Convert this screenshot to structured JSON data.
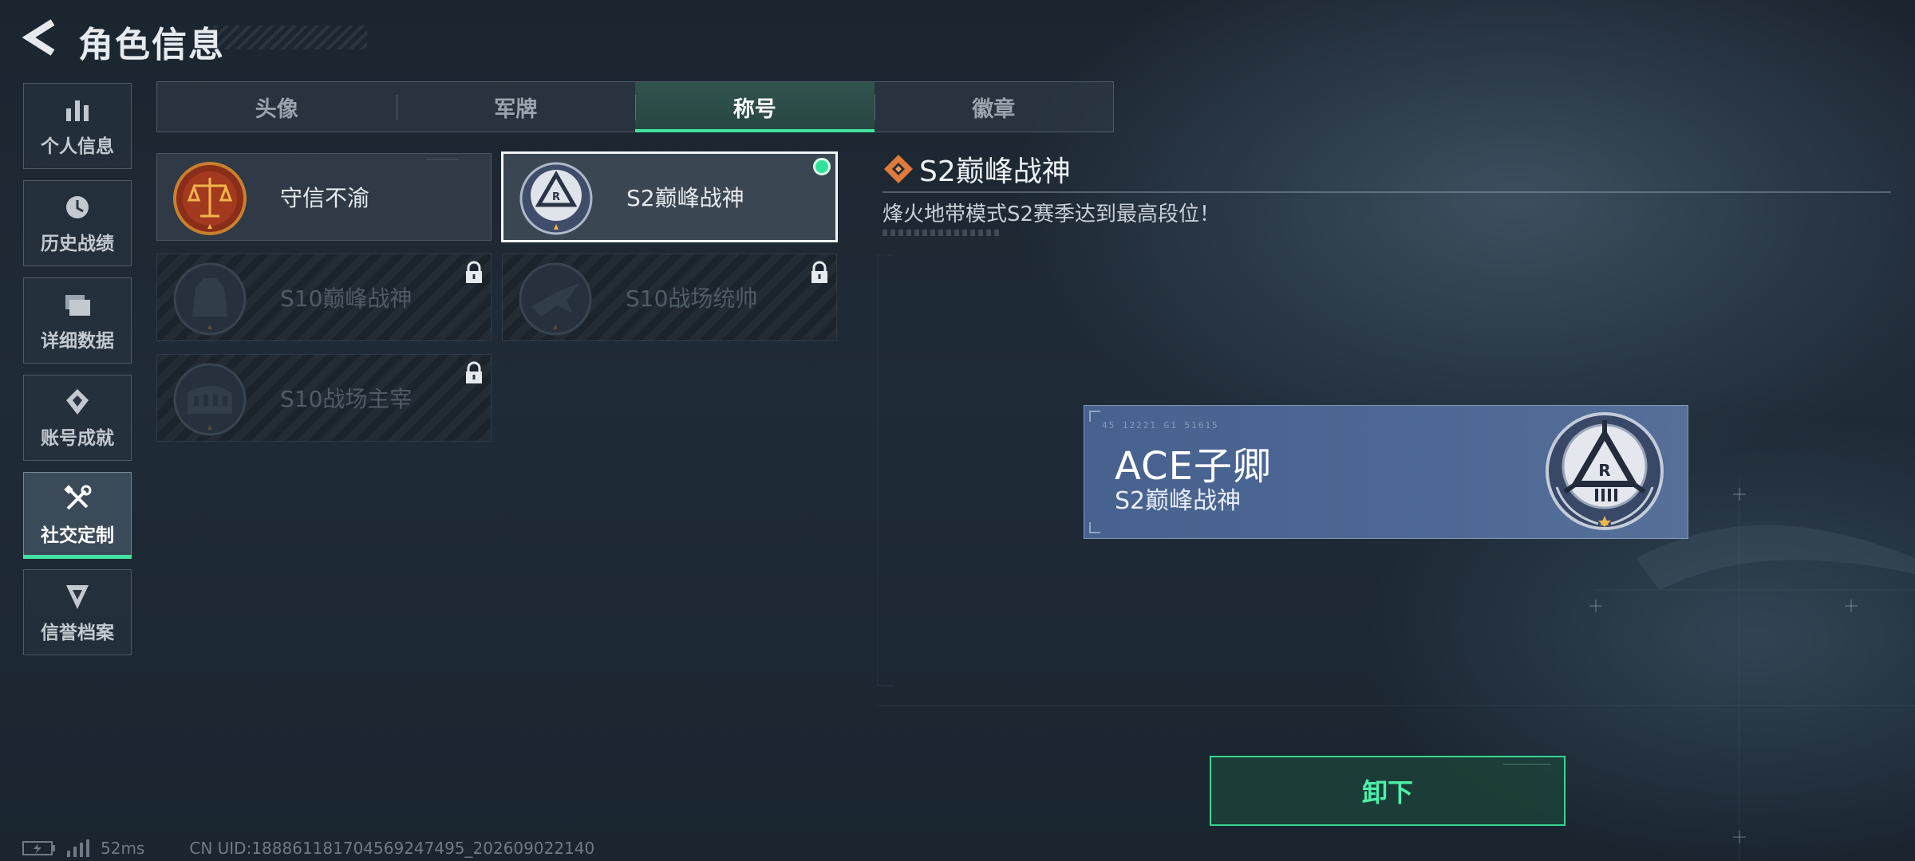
{
  "header": {
    "title": "角色信息"
  },
  "sidebar": {
    "items": [
      {
        "label": "个人信息",
        "icon": "bar-chart-icon",
        "active": false
      },
      {
        "label": "历史战绩",
        "icon": "clock-icon",
        "active": false
      },
      {
        "label": "详细数据",
        "icon": "folders-icon",
        "active": false
      },
      {
        "label": "账号成就",
        "icon": "achievement-icon",
        "active": false
      },
      {
        "label": "社交定制",
        "icon": "tools-icon",
        "active": true
      },
      {
        "label": "信誉档案",
        "icon": "shield-emblem-icon",
        "active": false
      }
    ]
  },
  "tabs": [
    {
      "label": "头像",
      "active": false
    },
    {
      "label": "军牌",
      "active": false
    },
    {
      "label": "称号",
      "active": true
    },
    {
      "label": "徽章",
      "active": false
    }
  ],
  "titles": [
    {
      "name": "守信不渝",
      "icon": "scales-badge-icon",
      "locked": false,
      "selected": false,
      "equipped": false
    },
    {
      "name": "S2巅峰战神",
      "icon": "rank-emblem-icon",
      "locked": false,
      "selected": true,
      "equipped": true
    },
    {
      "name": "S10巅峰战神",
      "icon": "building-badge-icon",
      "locked": true,
      "selected": false,
      "equipped": false
    },
    {
      "name": "S10战场统帅",
      "icon": "aircraft-badge-icon",
      "locked": true,
      "selected": false,
      "equipped": false
    },
    {
      "name": "S10战场主宰",
      "icon": "colosseum-badge-icon",
      "locked": true,
      "selected": false,
      "equipped": false
    }
  ],
  "detail": {
    "title": "S2巅峰战神",
    "description": "烽火地带模式S2赛季达到最高段位！"
  },
  "preview": {
    "code": "45 12221  G1 51615",
    "player_name": "ACE子卿",
    "title": "S2巅峰战神"
  },
  "actions": {
    "unequip_label": "卸下"
  },
  "status": {
    "ping": "52ms",
    "uid": "CN UID:18886118170456924749​5_202609022140"
  },
  "colors": {
    "accent": "#43e2a0",
    "plate": "#4a6591",
    "background": "#1e2a35"
  }
}
